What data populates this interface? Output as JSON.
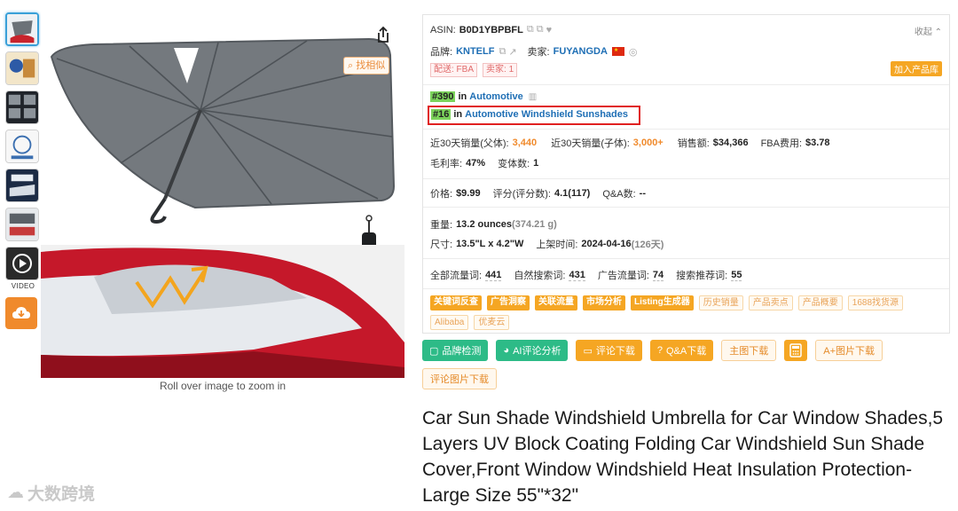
{
  "gallery": {
    "thumbnail_count": 6,
    "video_label": "VIDEO",
    "find_similar": "找相似",
    "zoom_hint": "Roll over image to zoom in"
  },
  "watermark": "大数跨境",
  "panel": {
    "asin_label": "ASIN:",
    "asin": "B0D1YBPBFL",
    "collapse": "收起",
    "brand_label": "品牌:",
    "brand": "KNTELF",
    "seller_label": "卖家:",
    "seller": "FUYANGDA",
    "delivery_tag": "配送: FBA",
    "sellers_tag": "卖家: 1",
    "add_to_library": "加入产品库",
    "rank1_num": "#390",
    "rank1_in": "in",
    "rank1_cat": "Automotive",
    "rank2_num": "#16",
    "rank2_in": "in",
    "rank2_cat": "Automotive Windshield Sunshades",
    "sales30_parent_label": "近30天销量(父体):",
    "sales30_parent": "3,440",
    "sales30_child_label": "近30天销量(子体):",
    "sales30_child": "3,000+",
    "revenue_label": "销售额:",
    "revenue": "$34,366",
    "fba_fee_label": "FBA费用:",
    "fba_fee": "$3.78",
    "margin_label": "毛利率:",
    "margin": "47%",
    "variants_label": "变体数:",
    "variants": "1",
    "price_label": "价格:",
    "price": "$9.99",
    "rating_label": "评分(评分数):",
    "rating": "4.1(117)",
    "qa_label": "Q&A数:",
    "qa": "--",
    "weight_label": "重量:",
    "weight": "13.2 ounces",
    "weight_g": "(374.21 g)",
    "size_label": "尺寸:",
    "size": "13.5\"L x 4.2\"W",
    "listed_label": "上架时间:",
    "listed": "2024-04-16",
    "listed_days": "(126天)",
    "kw_total_label": "全部流量词:",
    "kw_total": "441",
    "kw_organic_label": "自然搜索词:",
    "kw_organic": "431",
    "kw_ads_label": "广告流量词:",
    "kw_ads": "74",
    "kw_recommend_label": "搜索推荐词:",
    "kw_recommend": "55",
    "tools_solid": [
      "关键词反查",
      "广告洞察",
      "关联流量",
      "市场分析",
      "Listing生成器"
    ],
    "tools_outline": [
      "历史销量",
      "产品卖点",
      "产品概要",
      "1688找货源",
      "Alibaba",
      "优麦云"
    ]
  },
  "actions": {
    "brand_check": "品牌检测",
    "ai_review": "AI评论分析",
    "review_download": "评论下载",
    "qa_download": "Q&A下载",
    "main_img_download": "主图下载",
    "aplus_download": "A+图片下载",
    "review_img_download": "评论图片下载"
  },
  "product_title": "Car Sun Shade Windshield Umbrella for Car Window Shades,5 Layers UV Block Coating Folding Car Windshield Sun Shade Cover,Front Window Windshield Heat Insulation Protection-Large Size 55\"*32\""
}
